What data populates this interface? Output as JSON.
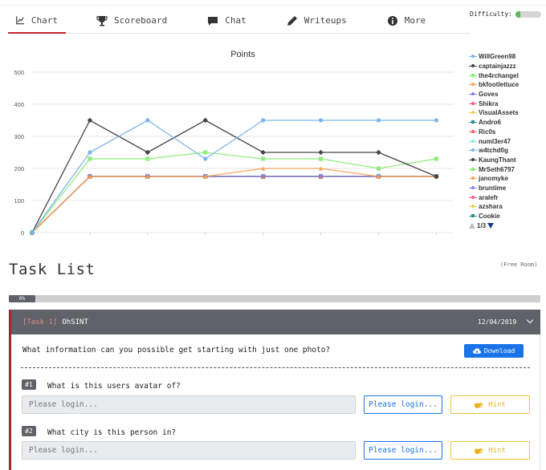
{
  "tabs": [
    {
      "label": "Chart",
      "icon": "line-chart-icon"
    },
    {
      "label": "Scoreboard",
      "icon": "trophy-icon"
    },
    {
      "label": "Chat",
      "icon": "chat-bubble-icon"
    },
    {
      "label": "Writeups",
      "icon": "pen-icon"
    },
    {
      "label": "More",
      "icon": "info-circle-icon"
    }
  ],
  "difficulty": {
    "label": "Difficulty:",
    "level": 0.2,
    "color": "#5cb85c"
  },
  "chart_data": {
    "type": "line",
    "title": "Points",
    "xlabel": "",
    "ylabel": "",
    "ylim": [
      0,
      500
    ],
    "yticks": [
      0,
      100,
      200,
      300,
      400,
      500
    ],
    "x": [
      0,
      1,
      2,
      3,
      4,
      5,
      6,
      7
    ],
    "grid": true,
    "legend_position": "right",
    "series": [
      {
        "name": "WillGreen98",
        "color": "#7cb5ec",
        "marker": "circle",
        "values": [
          0,
          250,
          350,
          230,
          350,
          350,
          350,
          350
        ]
      },
      {
        "name": "captainjazzz",
        "color": "#434348",
        "marker": "diamond",
        "values": [
          0,
          350,
          250,
          350,
          250,
          250,
          250,
          175
        ]
      },
      {
        "name": "the4rchangel",
        "color": "#90ed7d",
        "marker": "square",
        "values": [
          0,
          230,
          230,
          250,
          230,
          230,
          200,
          230
        ]
      },
      {
        "name": "bkfootlettuce",
        "color": "#f7a35c",
        "marker": "triangle",
        "values": [
          0,
          175,
          175,
          175,
          200,
          200,
          175,
          175
        ]
      },
      {
        "name": "Goves",
        "color": "#8085e9",
        "marker": "triangle-down",
        "values": [
          0,
          175,
          175,
          175,
          175,
          175,
          175,
          175
        ]
      },
      {
        "name": "Shikra",
        "color": "#f15c80",
        "marker": "circle",
        "values": [
          0,
          175,
          175,
          175,
          175,
          175,
          175,
          175
        ]
      },
      {
        "name": "VisualAssets",
        "color": "#e4d354",
        "marker": "diamond",
        "values": [
          0,
          175,
          175,
          175,
          175,
          175,
          175,
          175
        ]
      },
      {
        "name": "Andro6",
        "color": "#2b908f",
        "marker": "square",
        "values": [
          0,
          175,
          175,
          175,
          175,
          175,
          175,
          175
        ]
      },
      {
        "name": "Ric0s",
        "color": "#f45b5b",
        "marker": "triangle",
        "values": [
          0,
          175,
          175,
          175,
          175,
          175,
          175,
          175
        ]
      },
      {
        "name": "numl3er47",
        "color": "#91e8e1",
        "marker": "triangle-down",
        "values": [
          0,
          175,
          175,
          175,
          175,
          175,
          175,
          175
        ]
      },
      {
        "name": "w4tchd0g",
        "color": "#7cb5ec",
        "marker": "circle",
        "values": [
          0,
          175,
          175,
          175,
          175,
          175,
          175,
          175
        ]
      },
      {
        "name": "KaungThant",
        "color": "#434348",
        "marker": "diamond",
        "values": [
          0,
          175,
          175,
          175,
          175,
          175,
          175,
          175
        ]
      },
      {
        "name": "MrSeth6797",
        "color": "#90ed7d",
        "marker": "square",
        "values": [
          0,
          175,
          175,
          175,
          175,
          175,
          175,
          175
        ]
      },
      {
        "name": "janomyke",
        "color": "#f7a35c",
        "marker": "triangle",
        "values": [
          0,
          175,
          175,
          175,
          175,
          175,
          175,
          175
        ]
      },
      {
        "name": "bruntime",
        "color": "#8085e9",
        "marker": "triangle-down",
        "values": [
          0,
          175,
          175,
          175,
          175,
          175,
          175,
          175
        ]
      },
      {
        "name": "aralefr",
        "color": "#f15c80",
        "marker": "circle",
        "values": [
          0,
          175,
          175,
          175,
          175,
          175,
          175,
          175
        ]
      },
      {
        "name": "azshara",
        "color": "#e4d354",
        "marker": "diamond",
        "values": [
          0,
          175,
          175,
          175,
          175,
          175,
          175,
          175
        ]
      },
      {
        "name": "Cookie",
        "color": "#2b908f",
        "marker": "square",
        "values": [
          0,
          175,
          175,
          175,
          175,
          175,
          175,
          175
        ]
      }
    ],
    "legend_pager": "1/3"
  },
  "task_list": {
    "title": "Task List",
    "room_type": "(Free Room)",
    "progress_label": "0%",
    "progress_value": 0
  },
  "task": {
    "number": "[Task 1]",
    "name": "OhSINT",
    "date": "12/04/2019",
    "description": "What information can you possible get starting with just one photo?",
    "download_label": "Download",
    "questions": [
      {
        "badge": "#1",
        "text": "What is this users avatar of?",
        "placeholder": "Please login...",
        "submit_label": "Please login...",
        "hint_label": "Hint"
      },
      {
        "badge": "#2",
        "text": "What city is this person in?",
        "placeholder": "Please login...",
        "submit_label": "Please login...",
        "hint_label": "Hint"
      }
    ]
  }
}
